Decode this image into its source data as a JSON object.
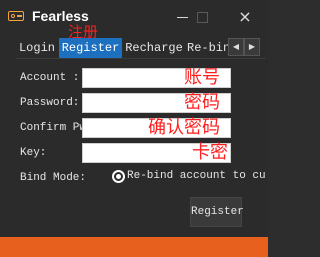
{
  "window": {
    "title": "Fearless",
    "icon": "key-card-icon",
    "controls": {
      "minimize": "minimize-icon",
      "maximize": "maximize-icon",
      "close": "×"
    }
  },
  "tabs": [
    {
      "label": "Login"
    },
    {
      "label": "Register",
      "active": true
    },
    {
      "label": "Recharge"
    },
    {
      "label": "Re-bin"
    }
  ],
  "tab_scroll": {
    "left": "◀",
    "right": "▶"
  },
  "annotations": {
    "register": "注册",
    "account": "账号",
    "password": "密码",
    "confirm": "确认密码",
    "key": "卡密"
  },
  "form": {
    "account_label": "Account :",
    "password_label": "Password:",
    "confirm_label": "Confirm Pw",
    "key_label": "Key:",
    "account_value": "",
    "password_value": "",
    "confirm_value": "",
    "key_value": "",
    "bind_mode_label": "Bind Mode:",
    "bind_mode_option": "Re-bind account to curren",
    "register_button": "Register"
  },
  "colors": {
    "background": "#2b2b2b",
    "active_tab": "#1d70c0",
    "annotation": "#ff1f1f",
    "accent_bar": "#e8601d",
    "icon": "#f2a33a"
  }
}
